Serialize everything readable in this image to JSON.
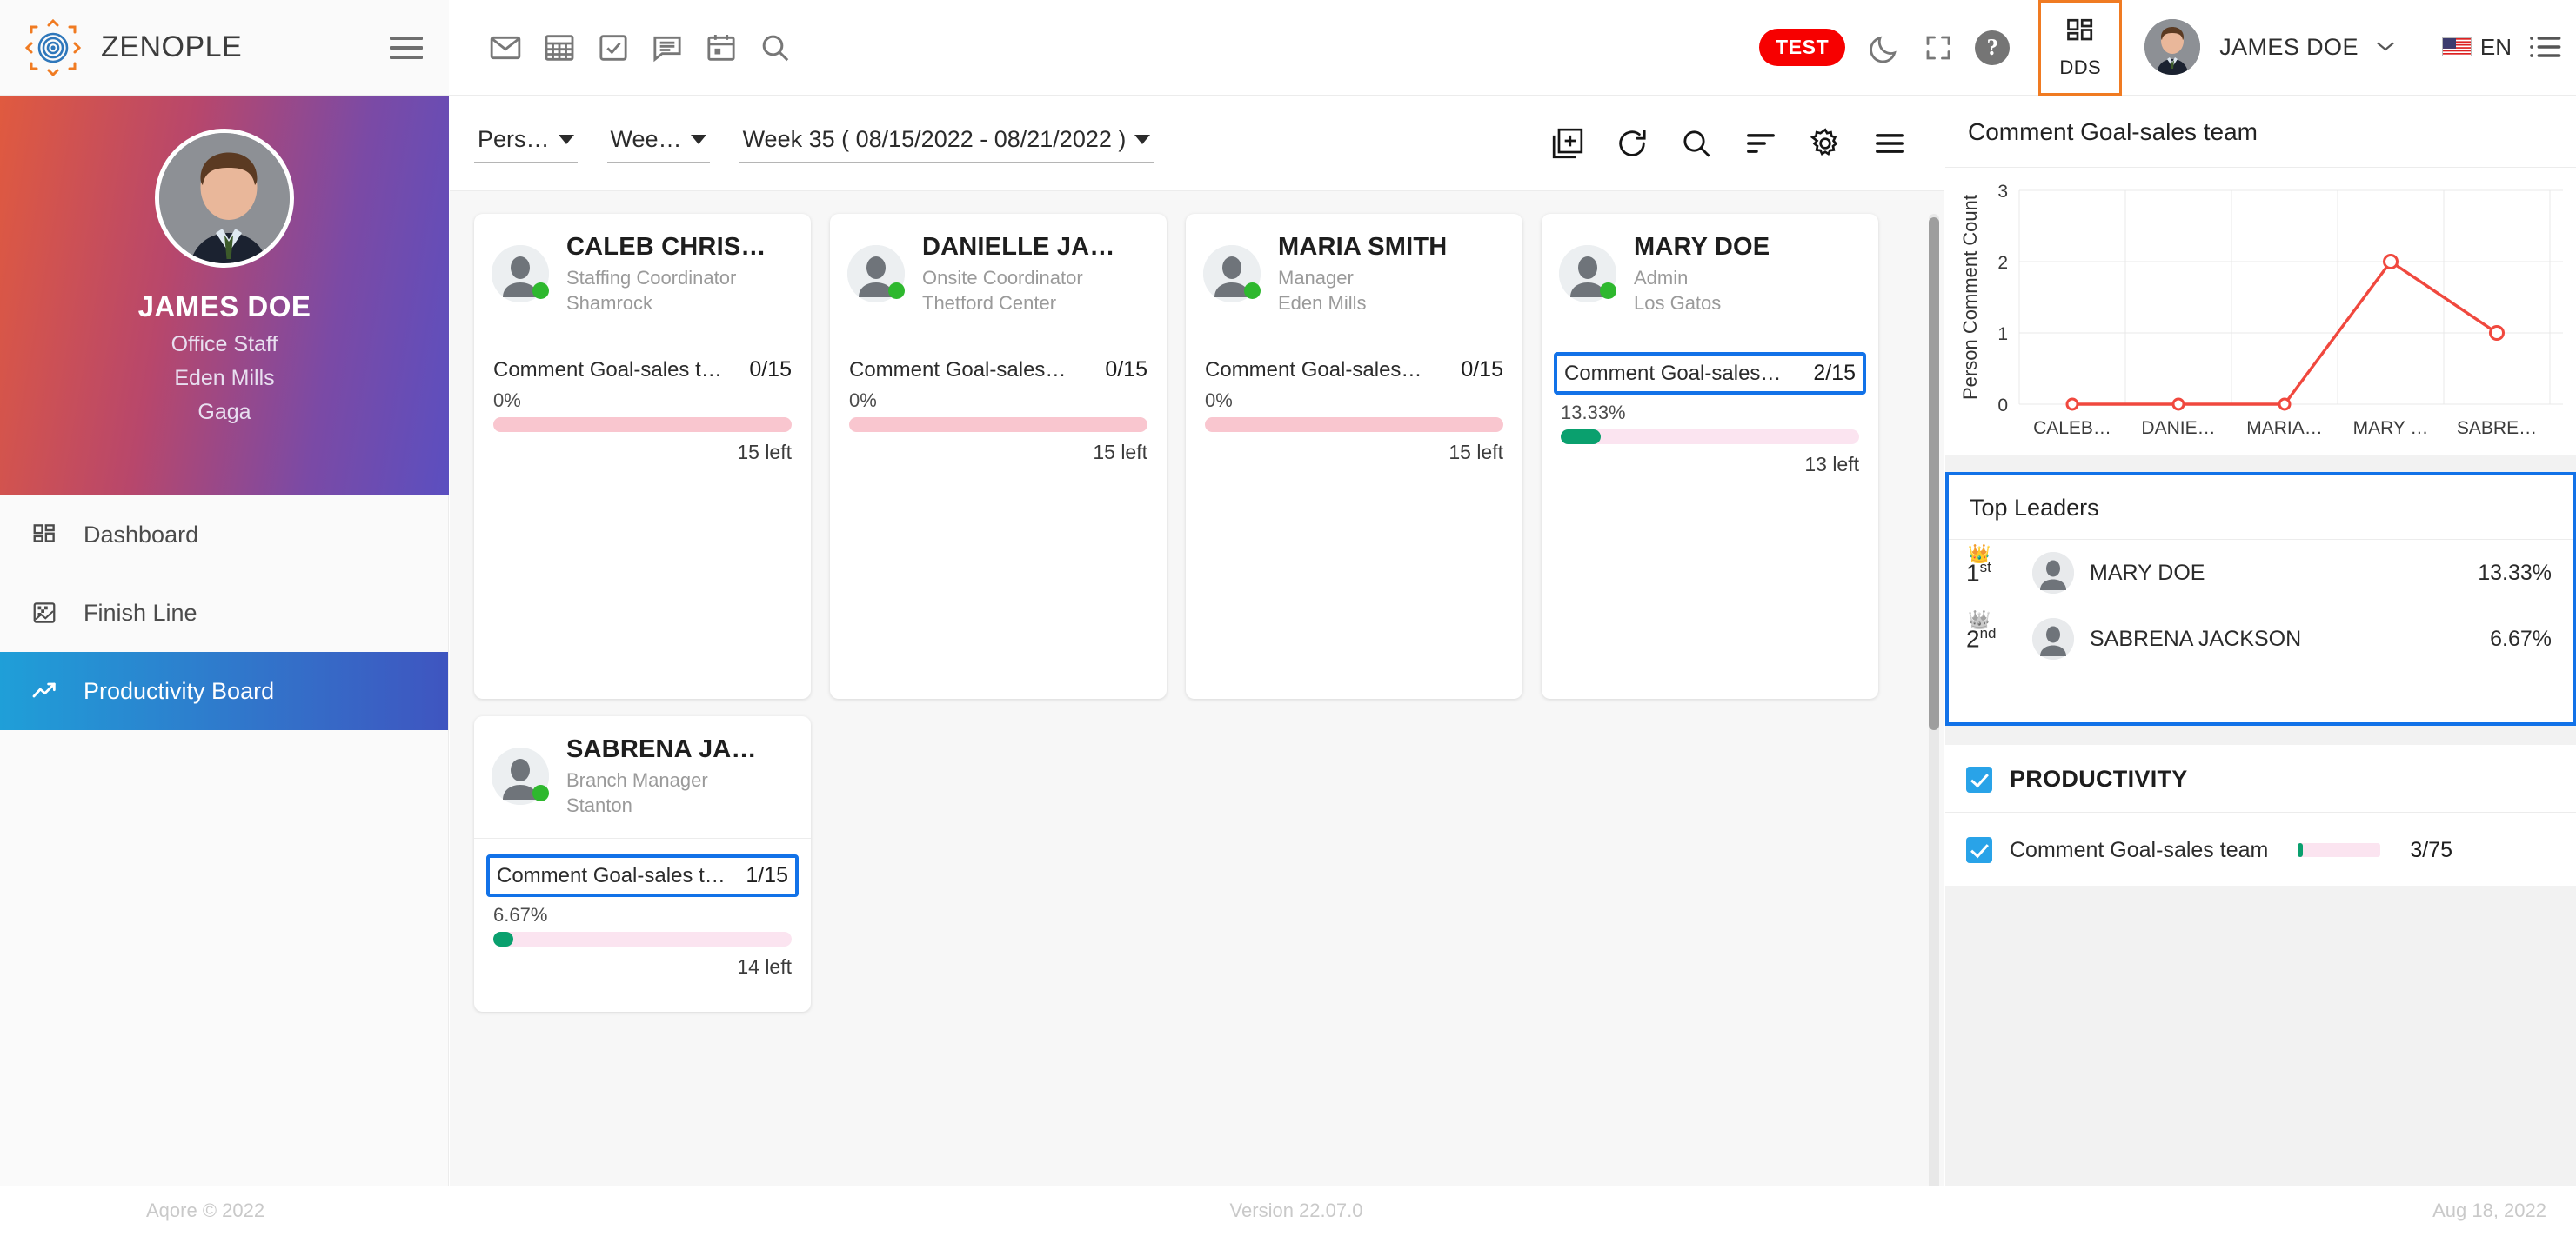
{
  "brand": {
    "name": "ZENOPLE",
    "logo_icon": "radial-target-icon",
    "menu_icon": "hamburger-icon"
  },
  "header": {
    "icons": [
      {
        "name": "mail-icon",
        "label": "Mail"
      },
      {
        "name": "calculator-icon",
        "label": "Calculator"
      },
      {
        "name": "task-check-icon",
        "label": "Tasks"
      },
      {
        "name": "chat-icon",
        "label": "Messages"
      },
      {
        "name": "calendar-icon",
        "label": "Calendar"
      },
      {
        "name": "search-icon",
        "label": "Search"
      }
    ],
    "test_badge": "TEST",
    "dark_mode_icon": "moon-icon",
    "fullscreen_icon": "fullscreen-icon",
    "help_glyph": "?",
    "dds_label": "DDS",
    "dds_icon": "dashboard-grid-icon",
    "user_name": "JAMES DOE",
    "user_chevron": "chevron-down-icon",
    "language": "EN",
    "flag_icon": "us-flag-icon",
    "right_menu_icon": "list-menu-icon"
  },
  "sidebar": {
    "profile": {
      "name": "JAMES DOE",
      "role": "Office Staff",
      "branch": "Eden Mills",
      "company": "Gaga"
    },
    "items": [
      {
        "label": "Dashboard",
        "icon": "dashboard-grid-icon",
        "active": false
      },
      {
        "label": "Finish Line",
        "icon": "finish-flag-icon",
        "active": false
      },
      {
        "label": "Productivity Board",
        "icon": "trend-up-icon",
        "active": true
      }
    ]
  },
  "filterbar": {
    "person_select": "Pers…",
    "week_select": "Wee…",
    "date_range": "Week 35 ( 08/15/2022 - 08/21/2022 )",
    "icons": [
      {
        "name": "add-board-icon"
      },
      {
        "name": "refresh-icon"
      },
      {
        "name": "search-icon"
      },
      {
        "name": "sort-icon"
      },
      {
        "name": "gear-icon"
      },
      {
        "name": "hamburger-icon"
      }
    ]
  },
  "cards": [
    {
      "name": "CALEB CHRIS…",
      "role": "Staffing Coordinator",
      "location": "Shamrock",
      "status": "online",
      "goal_label": "Comment Goal-sales t…",
      "goal_count": "0/15",
      "percent_label": "0%",
      "percent_value": 0,
      "left_label": "15 left",
      "selected": false
    },
    {
      "name": "DANIELLE JA…",
      "role": "Onsite Coordinator",
      "location": "Thetford Center",
      "status": "online",
      "goal_label": "Comment Goal-sales…",
      "goal_count": "0/15",
      "percent_label": "0%",
      "percent_value": 0,
      "left_label": "15 left",
      "selected": false
    },
    {
      "name": "MARIA SMITH",
      "role": "Manager",
      "location": "Eden Mills",
      "status": "online",
      "goal_label": "Comment Goal-sales…",
      "goal_count": "0/15",
      "percent_label": "0%",
      "percent_value": 0,
      "left_label": "15 left",
      "selected": false
    },
    {
      "name": "MARY DOE",
      "role": "Admin",
      "location": "Los Gatos",
      "status": "online",
      "goal_label": "Comment Goal-sales…",
      "goal_count": "2/15",
      "percent_label": "13.33%",
      "percent_value": 13.33,
      "left_label": "13 left",
      "selected": true
    },
    {
      "name": "SABRENA JA…",
      "role": "Branch Manager",
      "location": "Stanton",
      "status": "online",
      "goal_label": "Comment Goal-sales te…",
      "goal_count": "1/15",
      "percent_label": "6.67%",
      "percent_value": 6.67,
      "left_label": "14 left",
      "selected": true
    }
  ],
  "rightpanel": {
    "chart_title": "Comment Goal-sales team",
    "leaders_title": "Top Leaders",
    "leaders": [
      {
        "rank": "1",
        "suffix": "st",
        "name": "MARY DOE",
        "percent": "13.33%",
        "medal": "gold"
      },
      {
        "rank": "2",
        "suffix": "nd",
        "name": "SABRENA JACKSON",
        "percent": "6.67%",
        "medal": "silver"
      }
    ],
    "productivity_title": "PRODUCTIVITY",
    "productivity_checked": true,
    "productivity_rows": [
      {
        "label": "Comment Goal-sales team",
        "count": "3/75",
        "percent_value": 4,
        "checked": true
      }
    ]
  },
  "chart_data": {
    "type": "line",
    "title": "Comment Goal-sales team",
    "xlabel": "",
    "ylabel": "Person Comment Count",
    "categories": [
      "CALEB…",
      "DANIE…",
      "MARIA…",
      "MARY …",
      "SABRE…"
    ],
    "values": [
      0,
      0,
      0,
      2,
      1
    ],
    "yticks": [
      0,
      1,
      2,
      3
    ],
    "ylim": [
      0,
      3
    ],
    "series_color": "#f0483e",
    "marker": "open-circle",
    "grid": true,
    "legend": "none"
  },
  "footer": {
    "left": "Aqore © 2022",
    "middle": "Version 22.07.0",
    "right": "Aug 18, 2022"
  },
  "colors": {
    "accent_orange": "#f07b22",
    "selection_blue": "#1272e8",
    "danger_red": "#f70000",
    "progress_green": "#0aa06e",
    "progress_pink": "#fbe4f0",
    "empty_pink": "#f9c6cf"
  }
}
